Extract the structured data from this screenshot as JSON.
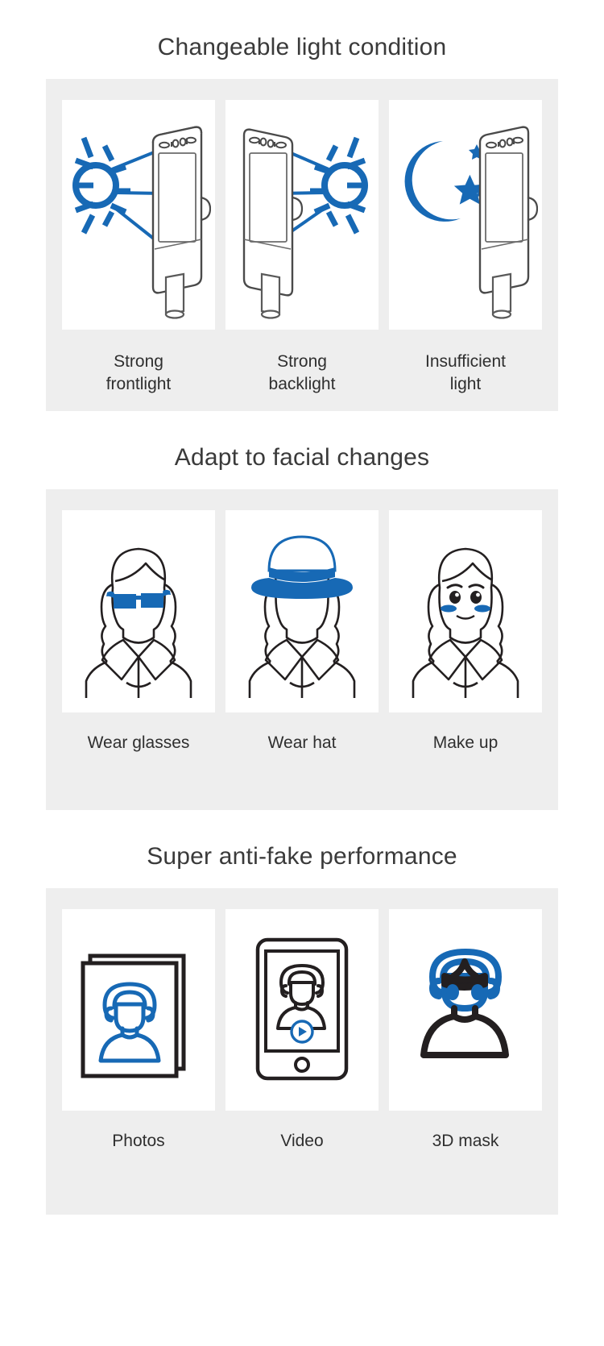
{
  "theme": {
    "accent_blue": "#1769b5",
    "outline_dark": "#231f20",
    "panel_gray": "#eeeeee",
    "card_white": "#ffffff",
    "page_background": "#ffffff",
    "title_color": "#3a3a3a"
  },
  "sections": [
    {
      "id": "light-condition",
      "title": "Changeable light condition",
      "cards": [
        {
          "caption": "Strong\nfrontlight",
          "caption_line1": "Strong",
          "caption_line2": "frontlight",
          "icon": "sun-left-terminal-icon"
        },
        {
          "caption": "Strong\nbacklight",
          "caption_line1": "Strong",
          "caption_line2": "backlight",
          "icon": "sun-right-terminal-icon"
        },
        {
          "caption": "Insufficient\nlight",
          "caption_line1": "Insufficient",
          "caption_line2": "light",
          "icon": "moon-stars-terminal-icon"
        }
      ]
    },
    {
      "id": "facial-changes",
      "title": "Adapt to facial changes",
      "cards": [
        {
          "caption": "Wear glasses",
          "caption_line1": "Wear glasses",
          "caption_line2": "",
          "icon": "woman-sunglasses-icon"
        },
        {
          "caption": "Wear hat",
          "caption_line1": "Wear hat",
          "caption_line2": "",
          "icon": "woman-hat-icon"
        },
        {
          "caption": "Make up",
          "caption_line1": "Make up",
          "caption_line2": "",
          "icon": "woman-makeup-icon"
        }
      ]
    },
    {
      "id": "anti-fake",
      "title": "Super anti-fake performance",
      "cards": [
        {
          "caption": "Photos",
          "caption_line1": "Photos",
          "caption_line2": "",
          "icon": "stacked-photos-icon"
        },
        {
          "caption": "Video",
          "caption_line1": "Video",
          "caption_line2": "",
          "icon": "tablet-video-icon"
        },
        {
          "caption": "3D mask",
          "caption_line1": "3D mask",
          "caption_line2": "",
          "icon": "three-d-mask-icon"
        }
      ]
    }
  ]
}
